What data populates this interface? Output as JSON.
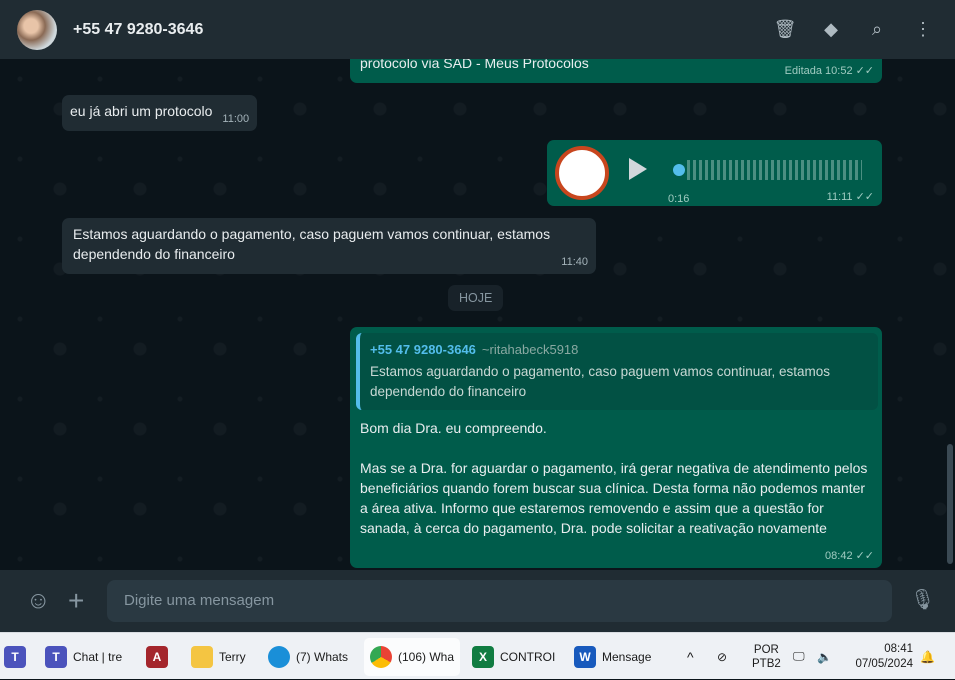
{
  "header": {
    "title": "+55 47 9280-3646",
    "icons": [
      "delete-icon",
      "label-icon",
      "search-icon",
      "menu-icon"
    ]
  },
  "messages": [
    {
      "dir": "out",
      "text": "protocolo via SAD - Meus Protocolos",
      "meta": "Editada 10:52"
    },
    {
      "dir": "in",
      "text": "eu já abri um protocolo",
      "time": "11:00"
    },
    {
      "dir": "out",
      "type": "audio",
      "duration": "0:16",
      "time": "11:11"
    },
    {
      "dir": "in",
      "text": "Estamos aguardando o pagamento, caso paguem vamos continuar, estamos dependendo do financeiro",
      "time": "11:40"
    },
    {
      "dir": "out",
      "quote": {
        "name": "+55 47 9280-3646",
        "alias": "~ritahabeck5918",
        "text": "Estamos aguardando o pagamento, caso paguem vamos continuar, estamos dependendo do financeiro"
      },
      "p1": "Bom dia Dra. eu compreendo.",
      "p2": "Mas se a Dra. for aguardar o pagamento, irá gerar negativa de atendimento pelos beneficiários quando forem buscar sua clínica. Desta forma não podemos manter a área ativa. Informo que estaremos removendo e assim que a questão for sanada, à cerca do pagamento, Dra. pode solicitar a reativação novamente",
      "time": "08:42"
    }
  ],
  "date_divider": "HOJE",
  "composer": {
    "placeholder": "Digite uma mensagem"
  },
  "taskbar": {
    "items": [
      "Chat | tre",
      "Terry",
      "(7) Whats",
      "(106) Wha",
      "CONTROI",
      "Mensage"
    ],
    "lang1": "POR",
    "lang2": "PTB2",
    "time": "08:41",
    "date": "07/05/2024"
  }
}
